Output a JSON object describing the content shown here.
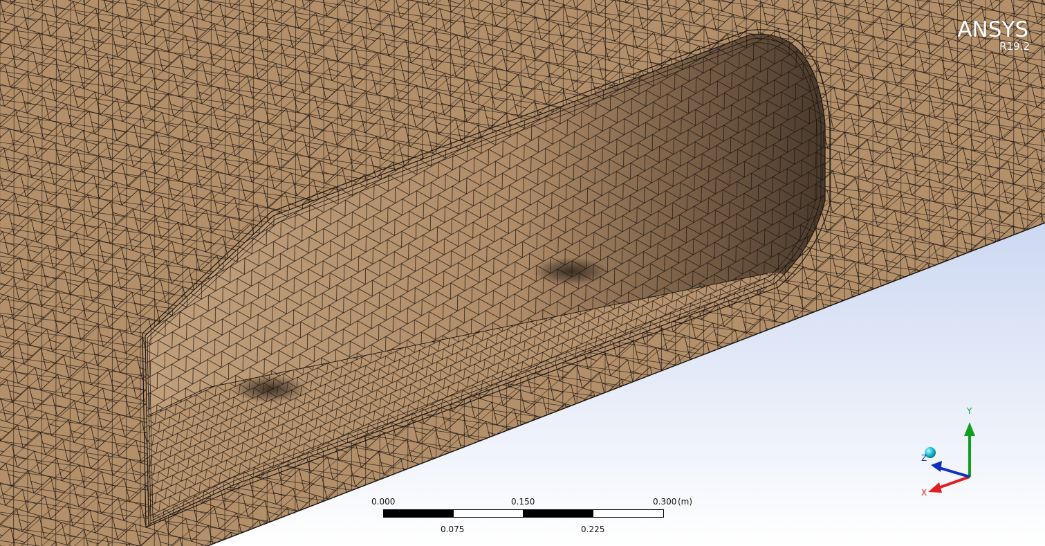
{
  "viewer": {
    "brand": "ANSYS",
    "release": "R19.2"
  },
  "scale_bar": {
    "top_labels": [
      "0.000",
      "0.150",
      "0.300"
    ],
    "bottom_labels": [
      "0.075",
      "0.225"
    ],
    "unit": "(m)"
  },
  "triad": {
    "x_label": "X",
    "y_label": "Y",
    "z_label": "Z"
  },
  "colors": {
    "mesh_face": "#b4906a",
    "mesh_lines": "#1a1410",
    "background_top": "#a9bde9",
    "background_bottom": "#ffffff",
    "axis_x": "#e02020",
    "axis_y": "#10a020",
    "axis_z": "#1030c0",
    "isometric_sphere": "#20c8d8"
  }
}
